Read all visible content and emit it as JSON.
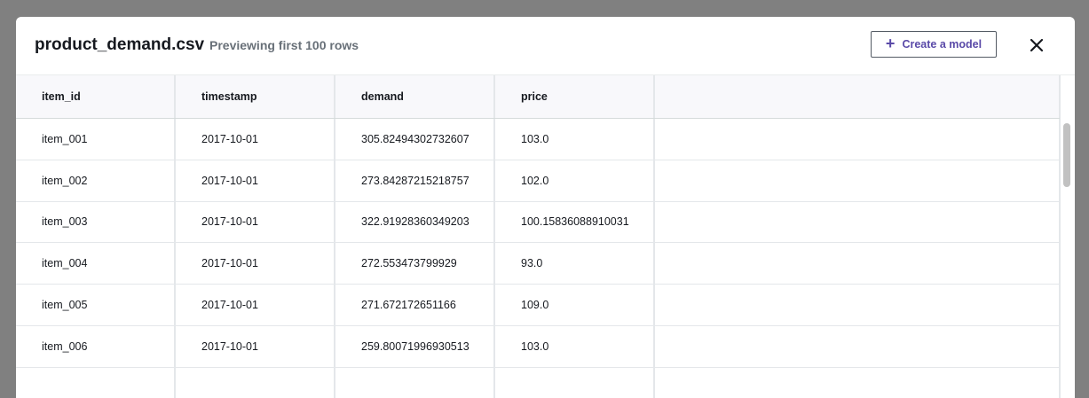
{
  "dialog": {
    "title": "product_demand.csv",
    "subtitle": "Previewing first 100 rows",
    "create_button_label": "Create a model",
    "create_icon": "plus-icon",
    "close_icon": "close-icon"
  },
  "table": {
    "columns": [
      "item_id",
      "timestamp",
      "demand",
      "price",
      ""
    ],
    "rows": [
      [
        "item_001",
        "2017-10-01",
        "305.82494302732607",
        "103.0"
      ],
      [
        "item_002",
        "2017-10-01",
        "273.84287215218757",
        "102.0"
      ],
      [
        "item_003",
        "2017-10-01",
        "322.91928360349203",
        "100.15836088910031"
      ],
      [
        "item_004",
        "2017-10-01",
        "272.553473799929",
        "93.0"
      ],
      [
        "item_005",
        "2017-10-01",
        "271.672172651166",
        "109.0"
      ],
      [
        "item_006",
        "2017-10-01",
        "259.80071996930513",
        "103.0"
      ],
      [
        "",
        "",
        "",
        ""
      ]
    ]
  },
  "colors": {
    "backdrop": "#808080",
    "accent": "#5a4aa8",
    "header_bg": "#f8f8fb",
    "text": "#16191f",
    "muted": "#687078"
  }
}
